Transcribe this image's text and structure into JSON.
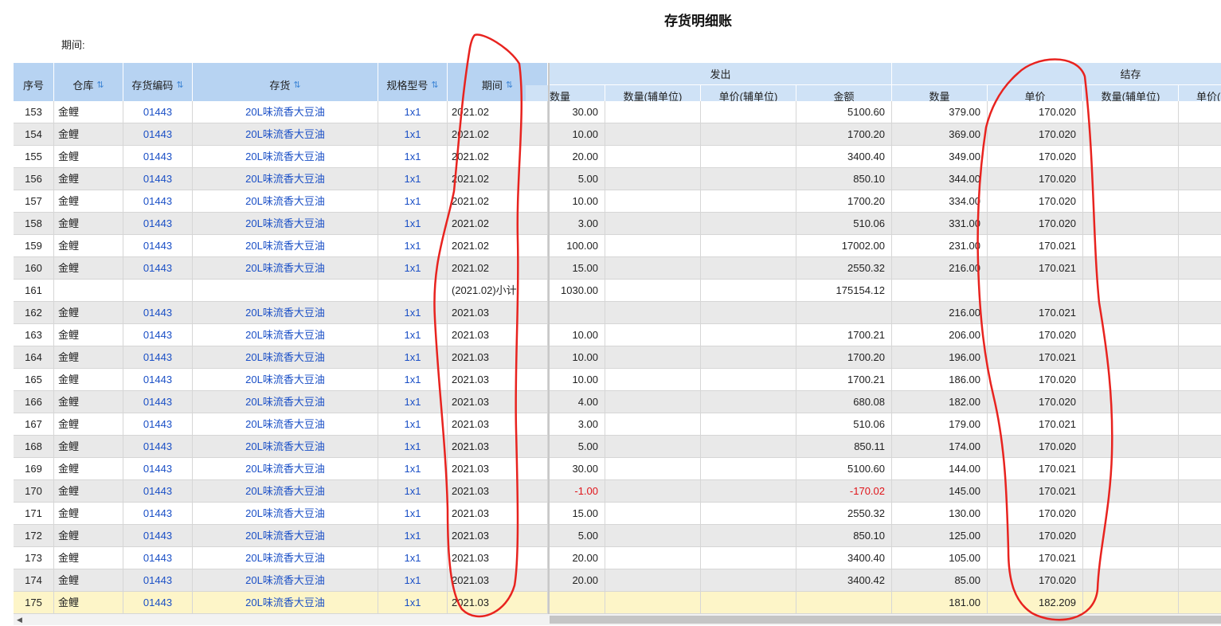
{
  "title": "存货明细账",
  "period_label": "期间:",
  "header": {
    "group_out": "发出",
    "group_balance": "结存",
    "cols": {
      "seq": "序号",
      "warehouse": "仓库",
      "code": "存货编码",
      "item": "存货",
      "spec": "规格型号",
      "period": "期间",
      "out_qty": "数量",
      "out_qty_aux": "数量(辅单位)",
      "out_price_aux": "单价(辅单位)",
      "out_amount": "金额",
      "bal_qty": "数量",
      "bal_price": "单价",
      "bal_qty_aux": "数量(辅单位)",
      "bal_price_aux": "单价("
    },
    "sort_icon": "sort-icon"
  },
  "rows": [
    {
      "seq": "153",
      "wh": "金鲤",
      "code": "01443",
      "item": "20L味流香大豆油",
      "spec": "1x1",
      "period": "2021.02",
      "oq": "30.00",
      "oqa": "",
      "opa": "",
      "oa": "5100.60",
      "bq": "379.00",
      "bp": "170.020",
      "neg": false
    },
    {
      "seq": "154",
      "wh": "金鲤",
      "code": "01443",
      "item": "20L味流香大豆油",
      "spec": "1x1",
      "period": "2021.02",
      "oq": "10.00",
      "oqa": "",
      "opa": "",
      "oa": "1700.20",
      "bq": "369.00",
      "bp": "170.020",
      "neg": false
    },
    {
      "seq": "155",
      "wh": "金鲤",
      "code": "01443",
      "item": "20L味流香大豆油",
      "spec": "1x1",
      "period": "2021.02",
      "oq": "20.00",
      "oqa": "",
      "opa": "",
      "oa": "3400.40",
      "bq": "349.00",
      "bp": "170.020",
      "neg": false
    },
    {
      "seq": "156",
      "wh": "金鲤",
      "code": "01443",
      "item": "20L味流香大豆油",
      "spec": "1x1",
      "period": "2021.02",
      "oq": "5.00",
      "oqa": "",
      "opa": "",
      "oa": "850.10",
      "bq": "344.00",
      "bp": "170.020",
      "neg": false
    },
    {
      "seq": "157",
      "wh": "金鲤",
      "code": "01443",
      "item": "20L味流香大豆油",
      "spec": "1x1",
      "period": "2021.02",
      "oq": "10.00",
      "oqa": "",
      "opa": "",
      "oa": "1700.20",
      "bq": "334.00",
      "bp": "170.020",
      "neg": false
    },
    {
      "seq": "158",
      "wh": "金鲤",
      "code": "01443",
      "item": "20L味流香大豆油",
      "spec": "1x1",
      "period": "2021.02",
      "oq": "3.00",
      "oqa": "",
      "opa": "",
      "oa": "510.06",
      "bq": "331.00",
      "bp": "170.020",
      "neg": false
    },
    {
      "seq": "159",
      "wh": "金鲤",
      "code": "01443",
      "item": "20L味流香大豆油",
      "spec": "1x1",
      "period": "2021.02",
      "oq": "100.00",
      "oqa": "",
      "opa": "",
      "oa": "17002.00",
      "bq": "231.00",
      "bp": "170.021",
      "neg": false
    },
    {
      "seq": "160",
      "wh": "金鲤",
      "code": "01443",
      "item": "20L味流香大豆油",
      "spec": "1x1",
      "period": "2021.02",
      "oq": "15.00",
      "oqa": "",
      "opa": "",
      "oa": "2550.32",
      "bq": "216.00",
      "bp": "170.021",
      "neg": false
    },
    {
      "seq": "161",
      "wh": "",
      "code": "",
      "item": "",
      "spec": "",
      "period": "(2021.02)小计:",
      "oq": "1030.00",
      "oqa": "",
      "opa": "",
      "oa": "175154.12",
      "bq": "",
      "bp": "",
      "neg": false
    },
    {
      "seq": "162",
      "wh": "金鲤",
      "code": "01443",
      "item": "20L味流香大豆油",
      "spec": "1x1",
      "period": "2021.03",
      "oq": "",
      "oqa": "",
      "opa": "",
      "oa": "",
      "bq": "216.00",
      "bp": "170.021",
      "neg": false
    },
    {
      "seq": "163",
      "wh": "金鲤",
      "code": "01443",
      "item": "20L味流香大豆油",
      "spec": "1x1",
      "period": "2021.03",
      "oq": "10.00",
      "oqa": "",
      "opa": "",
      "oa": "1700.21",
      "bq": "206.00",
      "bp": "170.020",
      "neg": false
    },
    {
      "seq": "164",
      "wh": "金鲤",
      "code": "01443",
      "item": "20L味流香大豆油",
      "spec": "1x1",
      "period": "2021.03",
      "oq": "10.00",
      "oqa": "",
      "opa": "",
      "oa": "1700.20",
      "bq": "196.00",
      "bp": "170.021",
      "neg": false
    },
    {
      "seq": "165",
      "wh": "金鲤",
      "code": "01443",
      "item": "20L味流香大豆油",
      "spec": "1x1",
      "period": "2021.03",
      "oq": "10.00",
      "oqa": "",
      "opa": "",
      "oa": "1700.21",
      "bq": "186.00",
      "bp": "170.020",
      "neg": false
    },
    {
      "seq": "166",
      "wh": "金鲤",
      "code": "01443",
      "item": "20L味流香大豆油",
      "spec": "1x1",
      "period": "2021.03",
      "oq": "4.00",
      "oqa": "",
      "opa": "",
      "oa": "680.08",
      "bq": "182.00",
      "bp": "170.020",
      "neg": false
    },
    {
      "seq": "167",
      "wh": "金鲤",
      "code": "01443",
      "item": "20L味流香大豆油",
      "spec": "1x1",
      "period": "2021.03",
      "oq": "3.00",
      "oqa": "",
      "opa": "",
      "oa": "510.06",
      "bq": "179.00",
      "bp": "170.021",
      "neg": false
    },
    {
      "seq": "168",
      "wh": "金鲤",
      "code": "01443",
      "item": "20L味流香大豆油",
      "spec": "1x1",
      "period": "2021.03",
      "oq": "5.00",
      "oqa": "",
      "opa": "",
      "oa": "850.11",
      "bq": "174.00",
      "bp": "170.020",
      "neg": false
    },
    {
      "seq": "169",
      "wh": "金鲤",
      "code": "01443",
      "item": "20L味流香大豆油",
      "spec": "1x1",
      "period": "2021.03",
      "oq": "30.00",
      "oqa": "",
      "opa": "",
      "oa": "5100.60",
      "bq": "144.00",
      "bp": "170.021",
      "neg": false
    },
    {
      "seq": "170",
      "wh": "金鲤",
      "code": "01443",
      "item": "20L味流香大豆油",
      "spec": "1x1",
      "period": "2021.03",
      "oq": "-1.00",
      "oqa": "",
      "opa": "",
      "oa": "-170.02",
      "bq": "145.00",
      "bp": "170.021",
      "neg": true
    },
    {
      "seq": "171",
      "wh": "金鲤",
      "code": "01443",
      "item": "20L味流香大豆油",
      "spec": "1x1",
      "period": "2021.03",
      "oq": "15.00",
      "oqa": "",
      "opa": "",
      "oa": "2550.32",
      "bq": "130.00",
      "bp": "170.020",
      "neg": false
    },
    {
      "seq": "172",
      "wh": "金鲤",
      "code": "01443",
      "item": "20L味流香大豆油",
      "spec": "1x1",
      "period": "2021.03",
      "oq": "5.00",
      "oqa": "",
      "opa": "",
      "oa": "850.10",
      "bq": "125.00",
      "bp": "170.020",
      "neg": false
    },
    {
      "seq": "173",
      "wh": "金鲤",
      "code": "01443",
      "item": "20L味流香大豆油",
      "spec": "1x1",
      "period": "2021.03",
      "oq": "20.00",
      "oqa": "",
      "opa": "",
      "oa": "3400.40",
      "bq": "105.00",
      "bp": "170.021",
      "neg": false
    },
    {
      "seq": "174",
      "wh": "金鲤",
      "code": "01443",
      "item": "20L味流香大豆油",
      "spec": "1x1",
      "period": "2021.03",
      "oq": "20.00",
      "oqa": "",
      "opa": "",
      "oa": "3400.42",
      "bq": "85.00",
      "bp": "170.020",
      "neg": false
    },
    {
      "seq": "175",
      "wh": "金鲤",
      "code": "01443",
      "item": "20L味流香大豆油",
      "spec": "1x1",
      "period": "2021.03",
      "oq": "",
      "oqa": "",
      "opa": "",
      "oa": "",
      "bq": "181.00",
      "bp": "182.209",
      "neg": false
    }
  ],
  "colors": {
    "header_bg": "#cfe2f6",
    "link": "#1a4fc6",
    "negative": "#e0141a",
    "highlight_row": "#fdf5c8",
    "annotation": "#e8231f"
  },
  "annotations": [
    "red-circle-period-column",
    "red-circle-unit-price-column"
  ]
}
